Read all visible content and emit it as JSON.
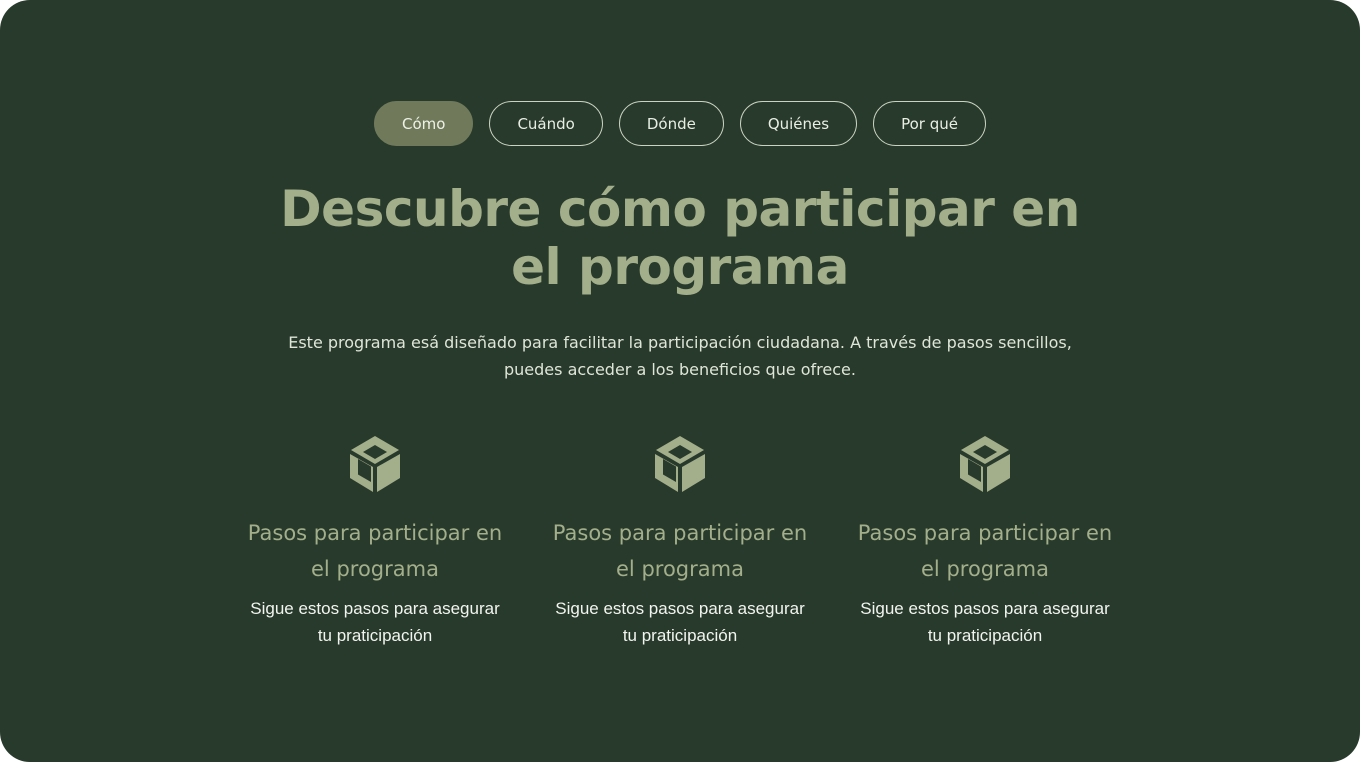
{
  "tabs": [
    {
      "label": "Cómo",
      "active": true
    },
    {
      "label": "Cuándo",
      "active": false
    },
    {
      "label": "Dónde",
      "active": false
    },
    {
      "label": "Quiénes",
      "active": false
    },
    {
      "label": "Por qué",
      "active": false
    }
  ],
  "hero": {
    "title_line1": "Descubre cómo participar en",
    "title_line2": "el programa",
    "intro_line1": "Este programa esá diseñado para facilitar la participación ciudadana. A través de pasos sencillos,",
    "intro_line2": "puedes acceder a los beneficios que ofrece."
  },
  "features": [
    {
      "icon": "cube-icon",
      "title_line1": "Pasos para participar en",
      "title_line2": "el programa",
      "desc_line1": "Sigue estos pasos para asegurar",
      "desc_line2": "tu praticipación"
    },
    {
      "icon": "cube-icon",
      "title_line1": "Pasos para participar en",
      "title_line2": "el programa",
      "desc_line1": "Sigue estos pasos para asegurar",
      "desc_line2": "tu praticipación"
    },
    {
      "icon": "cube-icon",
      "title_line1": "Pasos para participar en",
      "title_line2": "el programa",
      "desc_line1": "Sigue estos pasos para asegurar",
      "desc_line2": "tu praticipación"
    }
  ],
  "colors": {
    "background": "#283a2b",
    "accent": "#a3ae8b",
    "active_tab": "#707a5b",
    "text_light": "#dfe5d9"
  }
}
